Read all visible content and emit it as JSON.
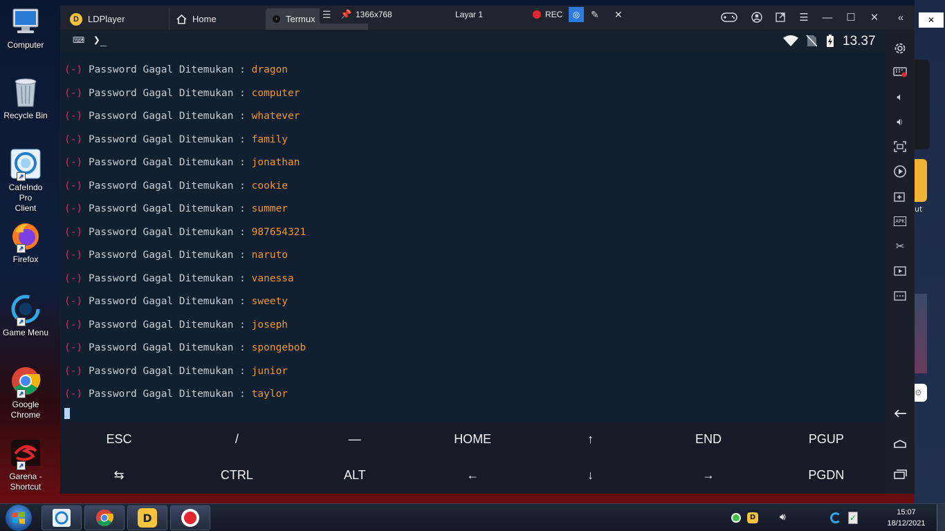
{
  "desktop": {
    "icons": [
      {
        "label": "Computer"
      },
      {
        "label": "Recycle Bin"
      },
      {
        "label": "CafeIndo Pro\nClient"
      },
      {
        "label": "Firefox"
      },
      {
        "label": "Game Menu"
      },
      {
        "label": "Google\nChrome"
      },
      {
        "label": "Garena -\nShortcut"
      }
    ],
    "right_fragment_text": "ut"
  },
  "window": {
    "tabs": [
      {
        "label": "LDPlayer"
      },
      {
        "label": "Home"
      },
      {
        "label": "Termux"
      }
    ],
    "toolbar": {
      "resolution": "1366x768",
      "layer": "Layar 1",
      "rec": "REC"
    }
  },
  "statusbar": {
    "time": "13.37",
    "prompt_symbol": "❯_"
  },
  "terminal": {
    "prefix": "(-)",
    "message": "Password Gagal Ditemukan :",
    "passwords": [
      "dragon",
      "computer",
      "whatever",
      "family",
      "jonathan",
      "cookie",
      "summer",
      "987654321",
      "naruto",
      "vanessa",
      "sweety",
      "joseph",
      "spongebob",
      "junior",
      "taylor"
    ]
  },
  "extra_keys": {
    "row1": [
      "ESC",
      "/",
      "—",
      "HOME",
      "↑",
      "END",
      "PGUP"
    ],
    "row2": [
      "⇆",
      "CTRL",
      "ALT",
      "←",
      "↓",
      "→",
      "PGDN"
    ]
  },
  "taskbar": {
    "time": "15:07",
    "date": "18/12/2021"
  },
  "colors": {
    "prefix": "#e0266e",
    "message": "#c9cdd3",
    "password": "#f0982a",
    "terminal_bg": "#102030"
  }
}
